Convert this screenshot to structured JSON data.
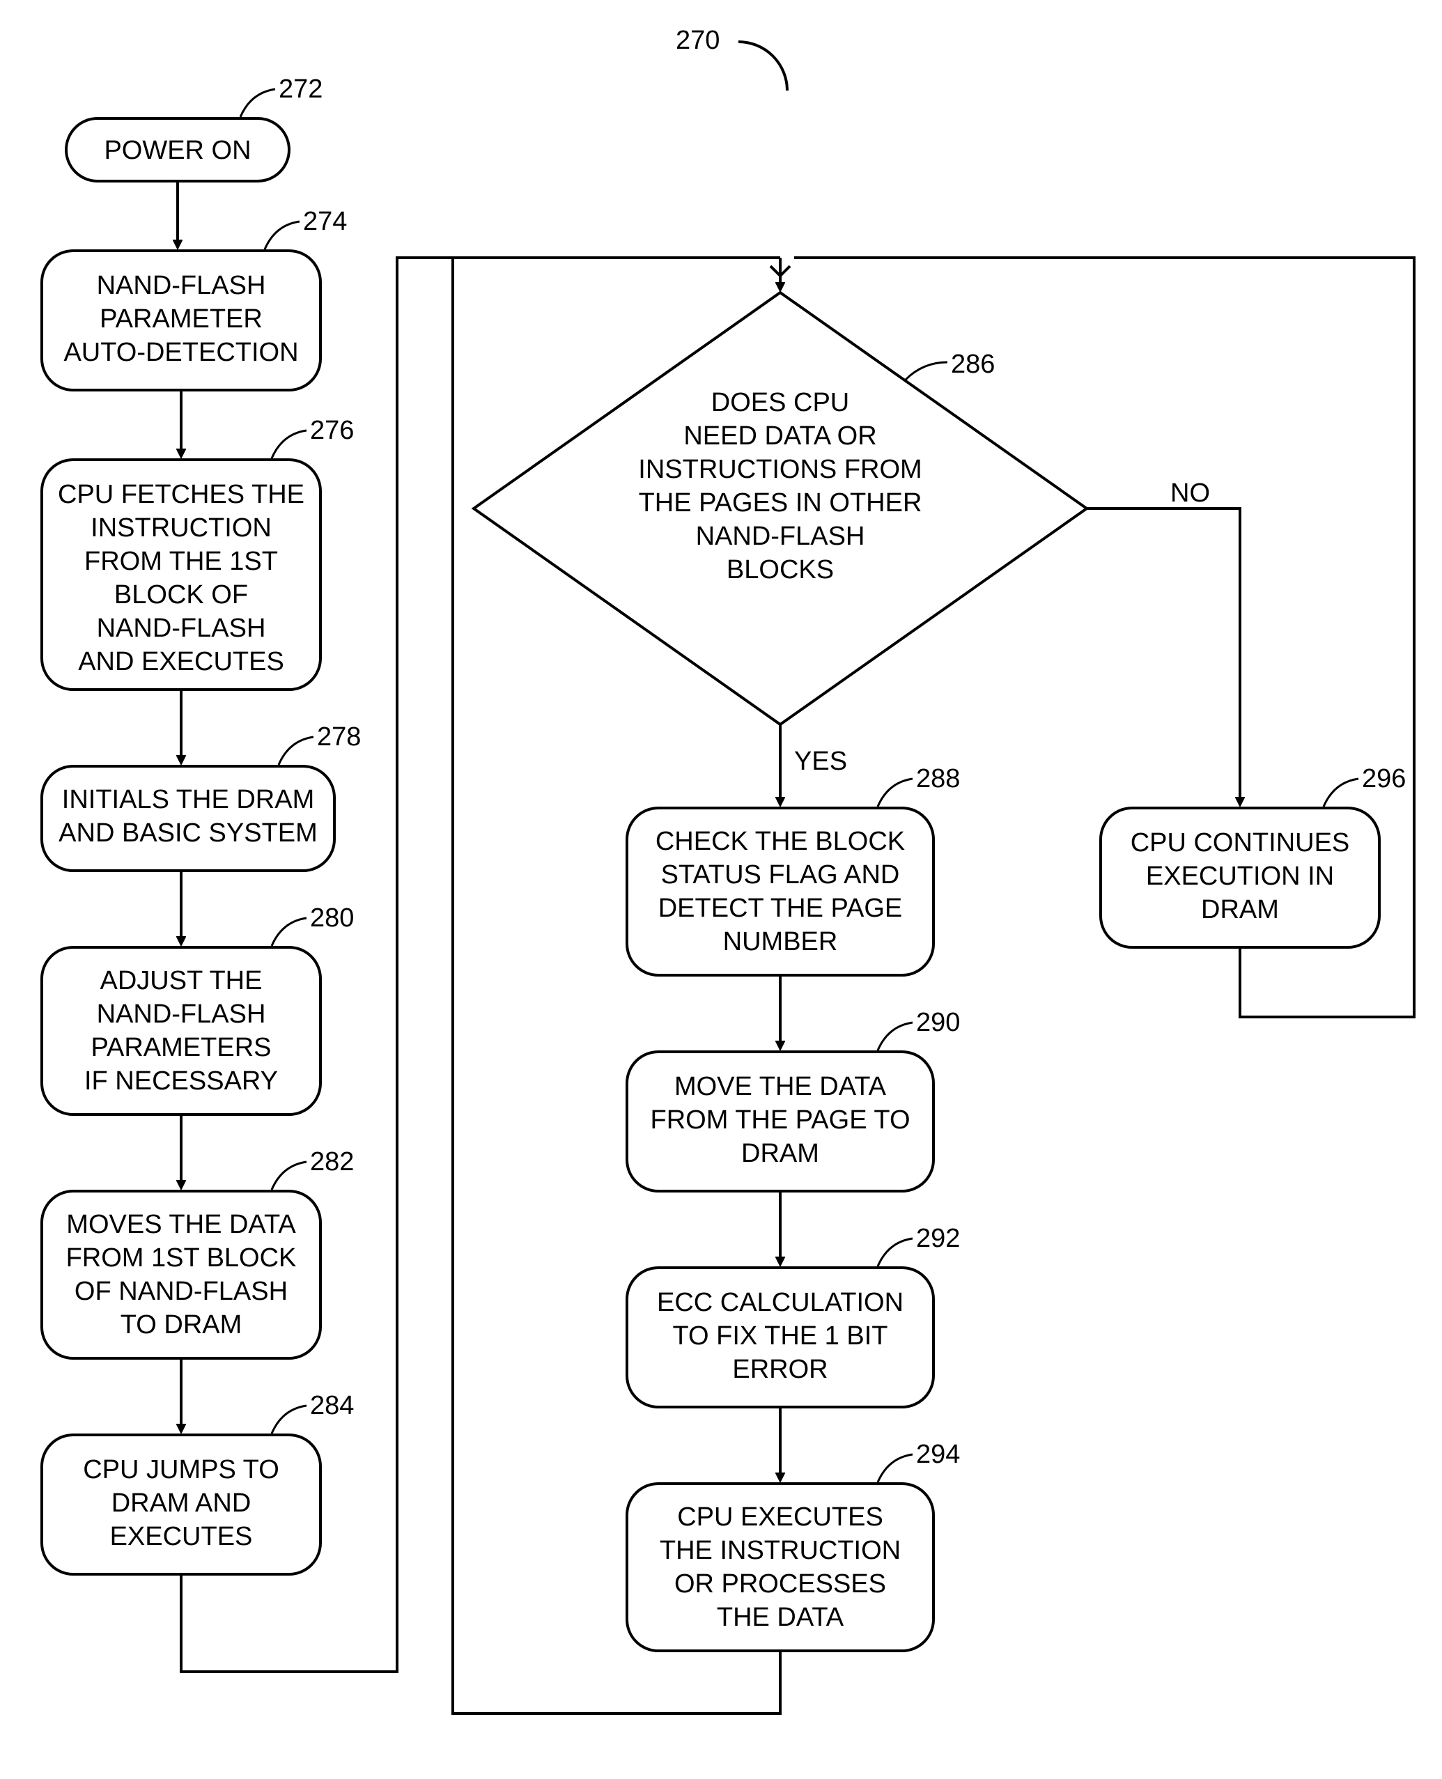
{
  "diagram_ref": "270",
  "nodes": {
    "n272": {
      "ref": "272",
      "lines": [
        "POWER ON"
      ]
    },
    "n274": {
      "ref": "274",
      "lines": [
        "NAND-FLASH",
        "PARAMETER",
        "AUTO-DETECTION"
      ]
    },
    "n276": {
      "ref": "276",
      "lines": [
        "CPU FETCHES THE",
        "INSTRUCTION",
        "FROM THE 1ST",
        "BLOCK OF",
        "NAND-FLASH",
        "AND EXECUTES"
      ]
    },
    "n278": {
      "ref": "278",
      "lines": [
        "INITIALS THE DRAM",
        "AND BASIC SYSTEM"
      ]
    },
    "n280": {
      "ref": "280",
      "lines": [
        "ADJUST THE",
        "NAND-FLASH",
        "PARAMETERS",
        "IF NECESSARY"
      ]
    },
    "n282": {
      "ref": "282",
      "lines": [
        "MOVES THE DATA",
        "FROM 1ST BLOCK",
        "OF NAND-FLASH",
        "TO DRAM"
      ]
    },
    "n284": {
      "ref": "284",
      "lines": [
        "CPU JUMPS TO",
        "DRAM AND",
        "EXECUTES"
      ]
    },
    "n286": {
      "ref": "286",
      "lines": [
        "DOES CPU",
        "NEED DATA OR",
        "INSTRUCTIONS FROM",
        "THE PAGES IN OTHER",
        "NAND-FLASH",
        "BLOCKS"
      ]
    },
    "n288": {
      "ref": "288",
      "lines": [
        "CHECK THE BLOCK",
        "STATUS FLAG AND",
        "DETECT THE PAGE",
        "NUMBER"
      ]
    },
    "n290": {
      "ref": "290",
      "lines": [
        "MOVE THE DATA",
        "FROM THE PAGE TO",
        "DRAM"
      ]
    },
    "n292": {
      "ref": "292",
      "lines": [
        "ECC CALCULATION",
        "TO FIX THE 1 BIT",
        "ERROR"
      ]
    },
    "n294": {
      "ref": "294",
      "lines": [
        "CPU EXECUTES",
        "THE INSTRUCTION",
        "OR PROCESSES",
        "THE DATA"
      ]
    },
    "n296": {
      "ref": "296",
      "lines": [
        "CPU CONTINUES",
        "EXECUTION IN",
        "DRAM"
      ]
    }
  },
  "edge_labels": {
    "yes": "YES",
    "no": "NO"
  }
}
